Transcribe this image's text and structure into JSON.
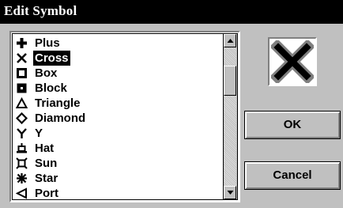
{
  "window": {
    "title": "Edit Symbol"
  },
  "symbols": {
    "items": [
      {
        "label": "Plus",
        "icon": "plus-icon",
        "selected": false
      },
      {
        "label": "Cross",
        "icon": "cross-icon",
        "selected": true
      },
      {
        "label": "Box",
        "icon": "box-icon",
        "selected": false
      },
      {
        "label": "Block",
        "icon": "block-icon",
        "selected": false
      },
      {
        "label": "Triangle",
        "icon": "triangle-icon",
        "selected": false
      },
      {
        "label": "Diamond",
        "icon": "diamond-icon",
        "selected": false
      },
      {
        "label": "Y",
        "icon": "y-icon",
        "selected": false
      },
      {
        "label": "Hat",
        "icon": "hat-icon",
        "selected": false
      },
      {
        "label": "Sun",
        "icon": "sun-icon",
        "selected": false
      },
      {
        "label": "Star",
        "icon": "star-icon",
        "selected": false
      },
      {
        "label": "Port",
        "icon": "port-icon",
        "selected": false
      }
    ]
  },
  "preview": {
    "icon": "cross-icon"
  },
  "buttons": {
    "ok_label": "OK",
    "cancel_label": "Cancel"
  },
  "colors": {
    "face": "#c0c0c0",
    "selection": "#000000",
    "title_bar": "#000000"
  }
}
